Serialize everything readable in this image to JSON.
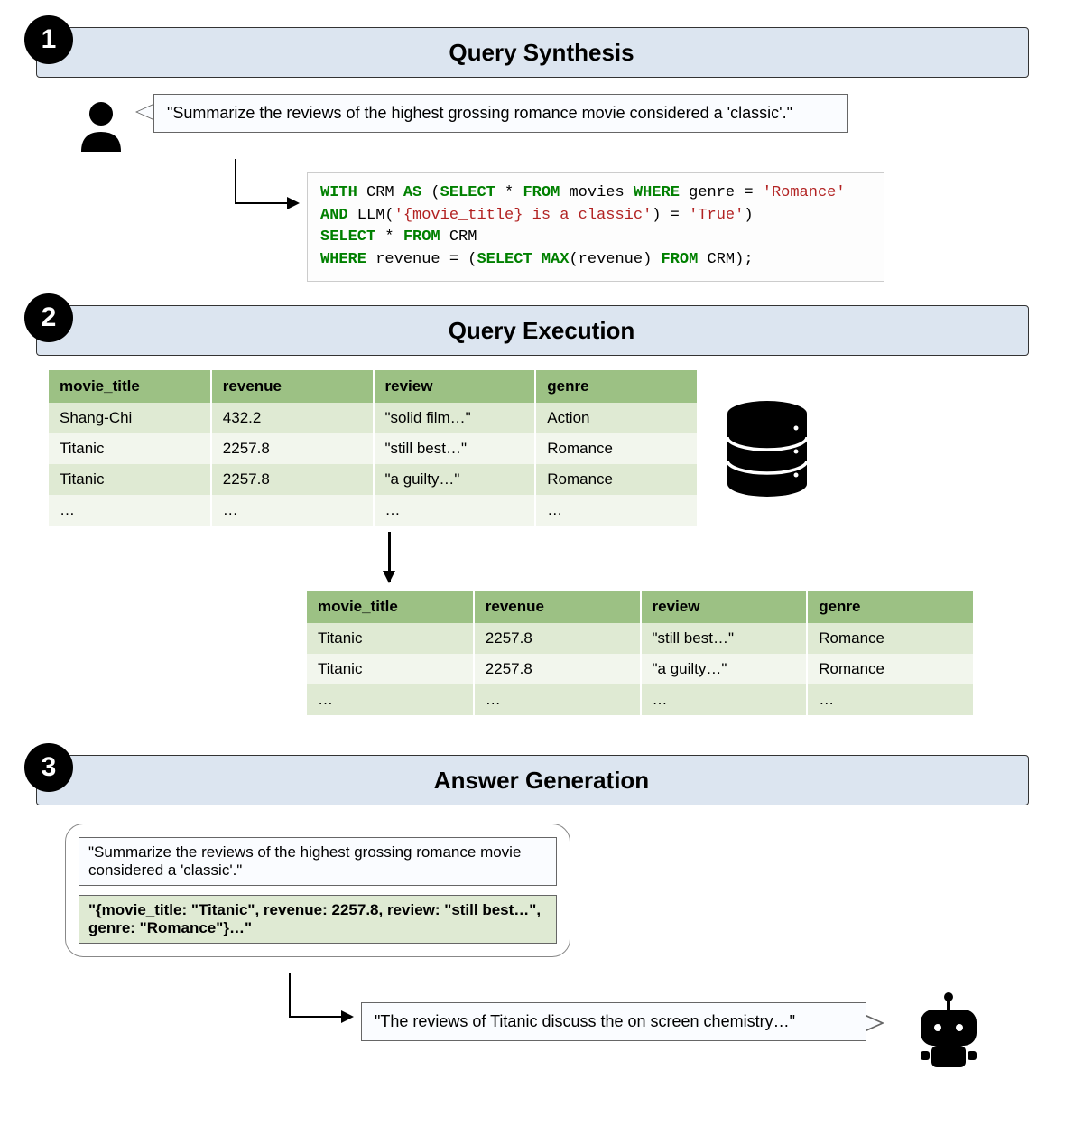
{
  "sections": {
    "s1": {
      "num": "1",
      "title": "Query Synthesis"
    },
    "s2": {
      "num": "2",
      "title": "Query Execution"
    },
    "s3": {
      "num": "3",
      "title": "Answer Generation"
    }
  },
  "s1": {
    "user_query": "\"Summarize the reviews of the highest grossing romance movie considered a 'classic'.\"",
    "sql": {
      "l1a": "WITH",
      "l1b": " CRM ",
      "l1c": "AS",
      "l1d": " (",
      "l1e": "SELECT",
      "l1f": " * ",
      "l1g": "FROM",
      "l1h": " movies ",
      "l1i": "WHERE",
      "l1j": " genre = ",
      "l1k": "'Romance'",
      "l2a": "AND",
      "l2b": " LLM(",
      "l2c": "'{movie_title} is a classic'",
      "l2d": ") = ",
      "l2e": "'True'",
      "l2f": ")",
      "l3a": "SELECT",
      "l3b": " * ",
      "l3c": "FROM",
      "l3d": " CRM",
      "l4a": "WHERE",
      "l4b": " revenue = (",
      "l4c": "SELECT MAX",
      "l4d": "(revenue) ",
      "l4e": "FROM",
      "l4f": " CRM);"
    }
  },
  "s2": {
    "table1": {
      "headers": [
        "movie_title",
        "revenue",
        "review",
        "genre"
      ],
      "rows": [
        [
          "Shang-Chi",
          "432.2",
          "\"solid film…\"",
          "Action"
        ],
        [
          "Titanic",
          "2257.8",
          "\"still best…\"",
          "Romance"
        ],
        [
          "Titanic",
          "2257.8",
          "\"a guilty…\"",
          "Romance"
        ],
        [
          "…",
          "…",
          "…",
          "…"
        ]
      ]
    },
    "table2": {
      "headers": [
        "movie_title",
        "revenue",
        "review",
        "genre"
      ],
      "rows": [
        [
          "Titanic",
          "2257.8",
          "\"still best…\"",
          "Romance"
        ],
        [
          "Titanic",
          "2257.8",
          "\"a guilty…\"",
          "Romance"
        ],
        [
          "…",
          "…",
          "…",
          "…"
        ]
      ]
    }
  },
  "s3": {
    "prompt_query": "\"Summarize the reviews of the highest grossing romance movie considered a 'classic'.\"",
    "prompt_context": "\"{movie_title: \"Titanic\", revenue: 2257.8, review: \"still best…\", genre: \"Romance\"}…\"",
    "answer": "\"The reviews of Titanic discuss the on screen chemistry…\""
  }
}
